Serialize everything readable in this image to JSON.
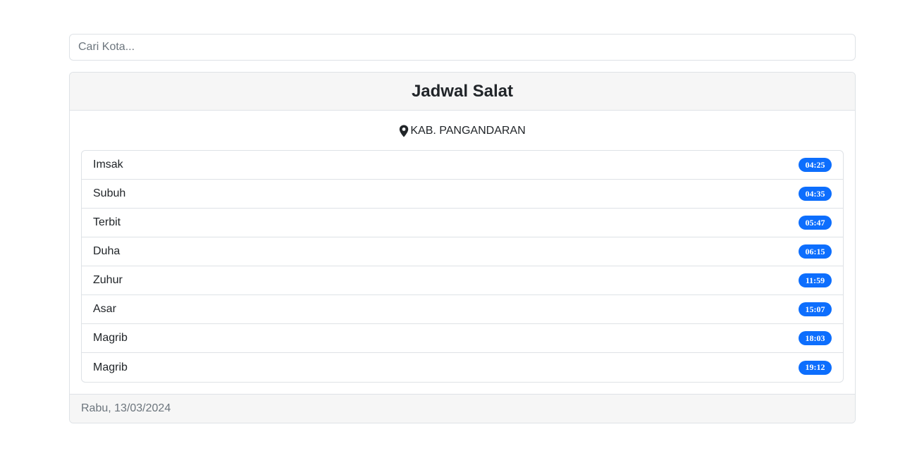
{
  "search": {
    "placeholder": "Cari Kota...",
    "value": ""
  },
  "card": {
    "title": "Jadwal Salat",
    "location": {
      "icon": "map-marker-icon",
      "name": "KAB. PANGANDARAN"
    },
    "times": [
      {
        "name": "Imsak",
        "time": "04:25"
      },
      {
        "name": "Subuh",
        "time": "04:35"
      },
      {
        "name": "Terbit",
        "time": "05:47"
      },
      {
        "name": "Duha",
        "time": "06:15"
      },
      {
        "name": "Zuhur",
        "time": "11:59"
      },
      {
        "name": "Asar",
        "time": "15:07"
      },
      {
        "name": "Magrib",
        "time": "18:03"
      },
      {
        "name": "Magrib",
        "time": "19:12"
      }
    ],
    "footer_date": "Rabu, 13/03/2024"
  },
  "colors": {
    "badge": "#0d6efd",
    "header_bg": "#f6f6f6",
    "border": "#dee2e6",
    "muted_text": "#6c757d"
  }
}
